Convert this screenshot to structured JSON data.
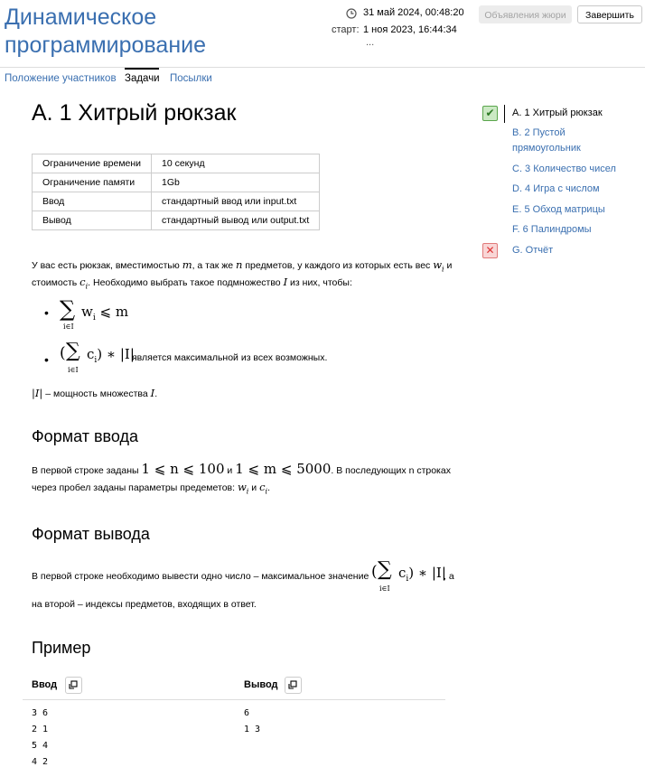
{
  "header": {
    "contest_title": "Динамическое программирование",
    "deadline": "31 май 2024, 00:48:20",
    "start_label": "старт:",
    "start_value": "1 ноя 2023, 16:44:34",
    "more": "...",
    "jury_button": "Объявления жюри",
    "finish_button": "Завершить"
  },
  "tabs": [
    "Положение участников",
    "Задачи",
    "Посылки"
  ],
  "problem": {
    "title": "A. 1 Хитрый рюкзак",
    "limits": [
      {
        "key": "Ограничение времени",
        "value": "10 секунд"
      },
      {
        "key": "Ограничение памяти",
        "value": "1Gb"
      },
      {
        "key": "Ввод",
        "value": "стандартный ввод или input.txt"
      },
      {
        "key": "Вывод",
        "value": "стандартный вывод или output.txt"
      }
    ],
    "statement": {
      "l1a": "У вас есть рюкзак, вместимостью ",
      "l1b": ", а так же ",
      "l1c": " предметов, у каждого из которых есть вес ",
      "l1d": " и",
      "l2a": "стоимость ",
      "l2b": ". Необходимо выбрать такое подмножество ",
      "l2c": " из них, чтобы:",
      "bullet2_text": "является максимальной из всех возможных.",
      "cardinality_text": " – мощность множества "
    },
    "input_heading": "Формат ввода",
    "input_text_a": "В первой строке заданы ",
    "input_text_and": " и ",
    "input_text_b": ". В последующих n строках",
    "input_text_c": "через пробел заданы параметры предеметов: ",
    "input_text_c2": " и ",
    "output_heading": "Формат вывода",
    "output_text_a": "В первой строке необходимо вывести одно число – максимальное значение ",
    "output_text_b": ", а",
    "output_text_c": "на второй – индексы предметов, входящих в ответ.",
    "example_heading": "Пример",
    "example_input_label": "Ввод",
    "example_output_label": "Вывод",
    "example_input": [
      "3 6",
      "2 1",
      "5 4",
      "4 2"
    ],
    "example_output": [
      "6",
      "1 3"
    ]
  },
  "sidebar": {
    "problems": [
      {
        "label": "A. 1 Хитрый рюкзак",
        "status": "accepted"
      },
      {
        "label": "B. 2 Пустой прямоугольник",
        "status": "none"
      },
      {
        "label": "C. 3 Количество чисел",
        "status": "none"
      },
      {
        "label": "D. 4 Игра с числом",
        "status": "none"
      },
      {
        "label": "E. 5 Обход матрицы",
        "status": "none"
      },
      {
        "label": "F. 6 Палиндромы",
        "status": "none"
      },
      {
        "label": "G. Отчёт",
        "status": "rejected"
      }
    ]
  },
  "colors": {
    "link": "#3a6fb0",
    "accepted": "#5aa54c",
    "rejected": "#e07a7a"
  }
}
